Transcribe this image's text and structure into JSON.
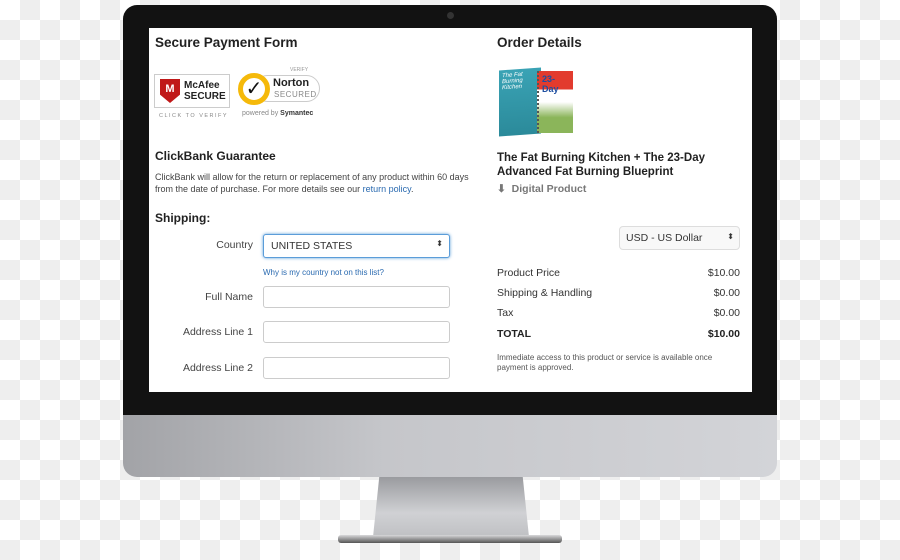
{
  "left": {
    "title": "Secure Payment Form",
    "badges": {
      "mcafee": {
        "line1": "McAfee",
        "line2": "SECURE",
        "caption": "CLICK TO VERIFY"
      },
      "norton": {
        "top": "VERIFY",
        "line1": "Norton",
        "line2": "SECURED",
        "caption_prefix": "powered by",
        "caption_brand": "Symantec"
      }
    },
    "guarantee": {
      "title": "ClickBank Guarantee",
      "text": "ClickBank will allow for the return or replacement of any product within 60 days from the date of purchase. For more details see our ",
      "link": "return policy",
      "end": "."
    },
    "shipping": {
      "title": "Shipping:",
      "country_label": "Country",
      "country_value": "UNITED STATES",
      "country_help": "Why is my country not on this list?",
      "full_name_label": "Full Name",
      "address1_label": "Address Line 1",
      "address2_label": "Address Line 2"
    }
  },
  "right": {
    "title": "Order Details",
    "product_name": "The Fat Burning Kitchen + The 23-Day Advanced Fat Burning Blueprint",
    "product_type": "Digital Product",
    "cover_text": {
      "book1": "The Fat Burning Kitchen",
      "book2": "23-Day"
    },
    "currency": "USD - US Dollar",
    "lines": [
      {
        "label": "Product Price",
        "value": "$10.00"
      },
      {
        "label": "Shipping & Handling",
        "value": "$0.00"
      },
      {
        "label": "Tax",
        "value": "$0.00"
      },
      {
        "label": "TOTAL",
        "value": "$10.00"
      }
    ],
    "note": "Immediate access to this product or service is available once payment is approved."
  },
  "colors": {
    "link": "#2a6ab0",
    "focus": "#5b9dd9",
    "mcafee_red": "#c01818",
    "norton_yellow": "#f5b90a"
  }
}
